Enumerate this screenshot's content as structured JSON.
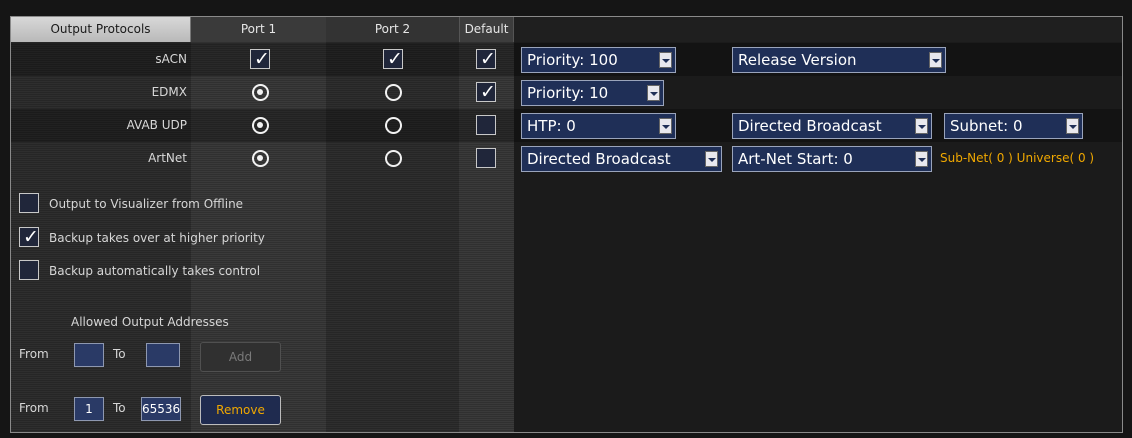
{
  "header": {
    "output_protocols": "Output Protocols",
    "port1": "Port 1",
    "port2": "Port 2",
    "default": "Default"
  },
  "protocols": [
    {
      "name": "sACN",
      "port1": "checkbox-checked",
      "port2": "checkbox-checked",
      "default": true,
      "dropdowns": [
        "Priority: 100",
        "Release Version"
      ],
      "note": ""
    },
    {
      "name": "EDMX",
      "port1": "radio-selected",
      "port2": "radio-unselected",
      "default": true,
      "dropdowns": [
        "Priority: 10"
      ],
      "note": ""
    },
    {
      "name": "AVAB UDP",
      "port1": "radio-selected",
      "port2": "radio-unselected",
      "default": false,
      "dropdowns": [
        "HTP: 0",
        "Directed Broadcast",
        "Subnet: 0"
      ],
      "note": ""
    },
    {
      "name": "ArtNet",
      "port1": "radio-selected",
      "port2": "radio-unselected",
      "default": false,
      "dropdowns": [
        "Directed Broadcast",
        "Art-Net Start: 0"
      ],
      "note": "Sub-Net( 0 ) Universe( 0 )"
    }
  ],
  "options": [
    {
      "label": "Output to Visualizer from Offline",
      "checked": false
    },
    {
      "label": "Backup takes over at higher priority",
      "checked": true
    },
    {
      "label": "Backup automatically takes control",
      "checked": false
    }
  ],
  "addresses": {
    "title": "Allowed Output Addresses",
    "from_label": "From",
    "to_label": "To",
    "new_from": "",
    "new_to": "",
    "add_label": "Add",
    "existing_from": "1",
    "existing_to": "65536",
    "remove_label": "Remove"
  },
  "colors": {
    "accent_orange": "#f0a800",
    "dropdown_blue": "#1f2f57"
  }
}
